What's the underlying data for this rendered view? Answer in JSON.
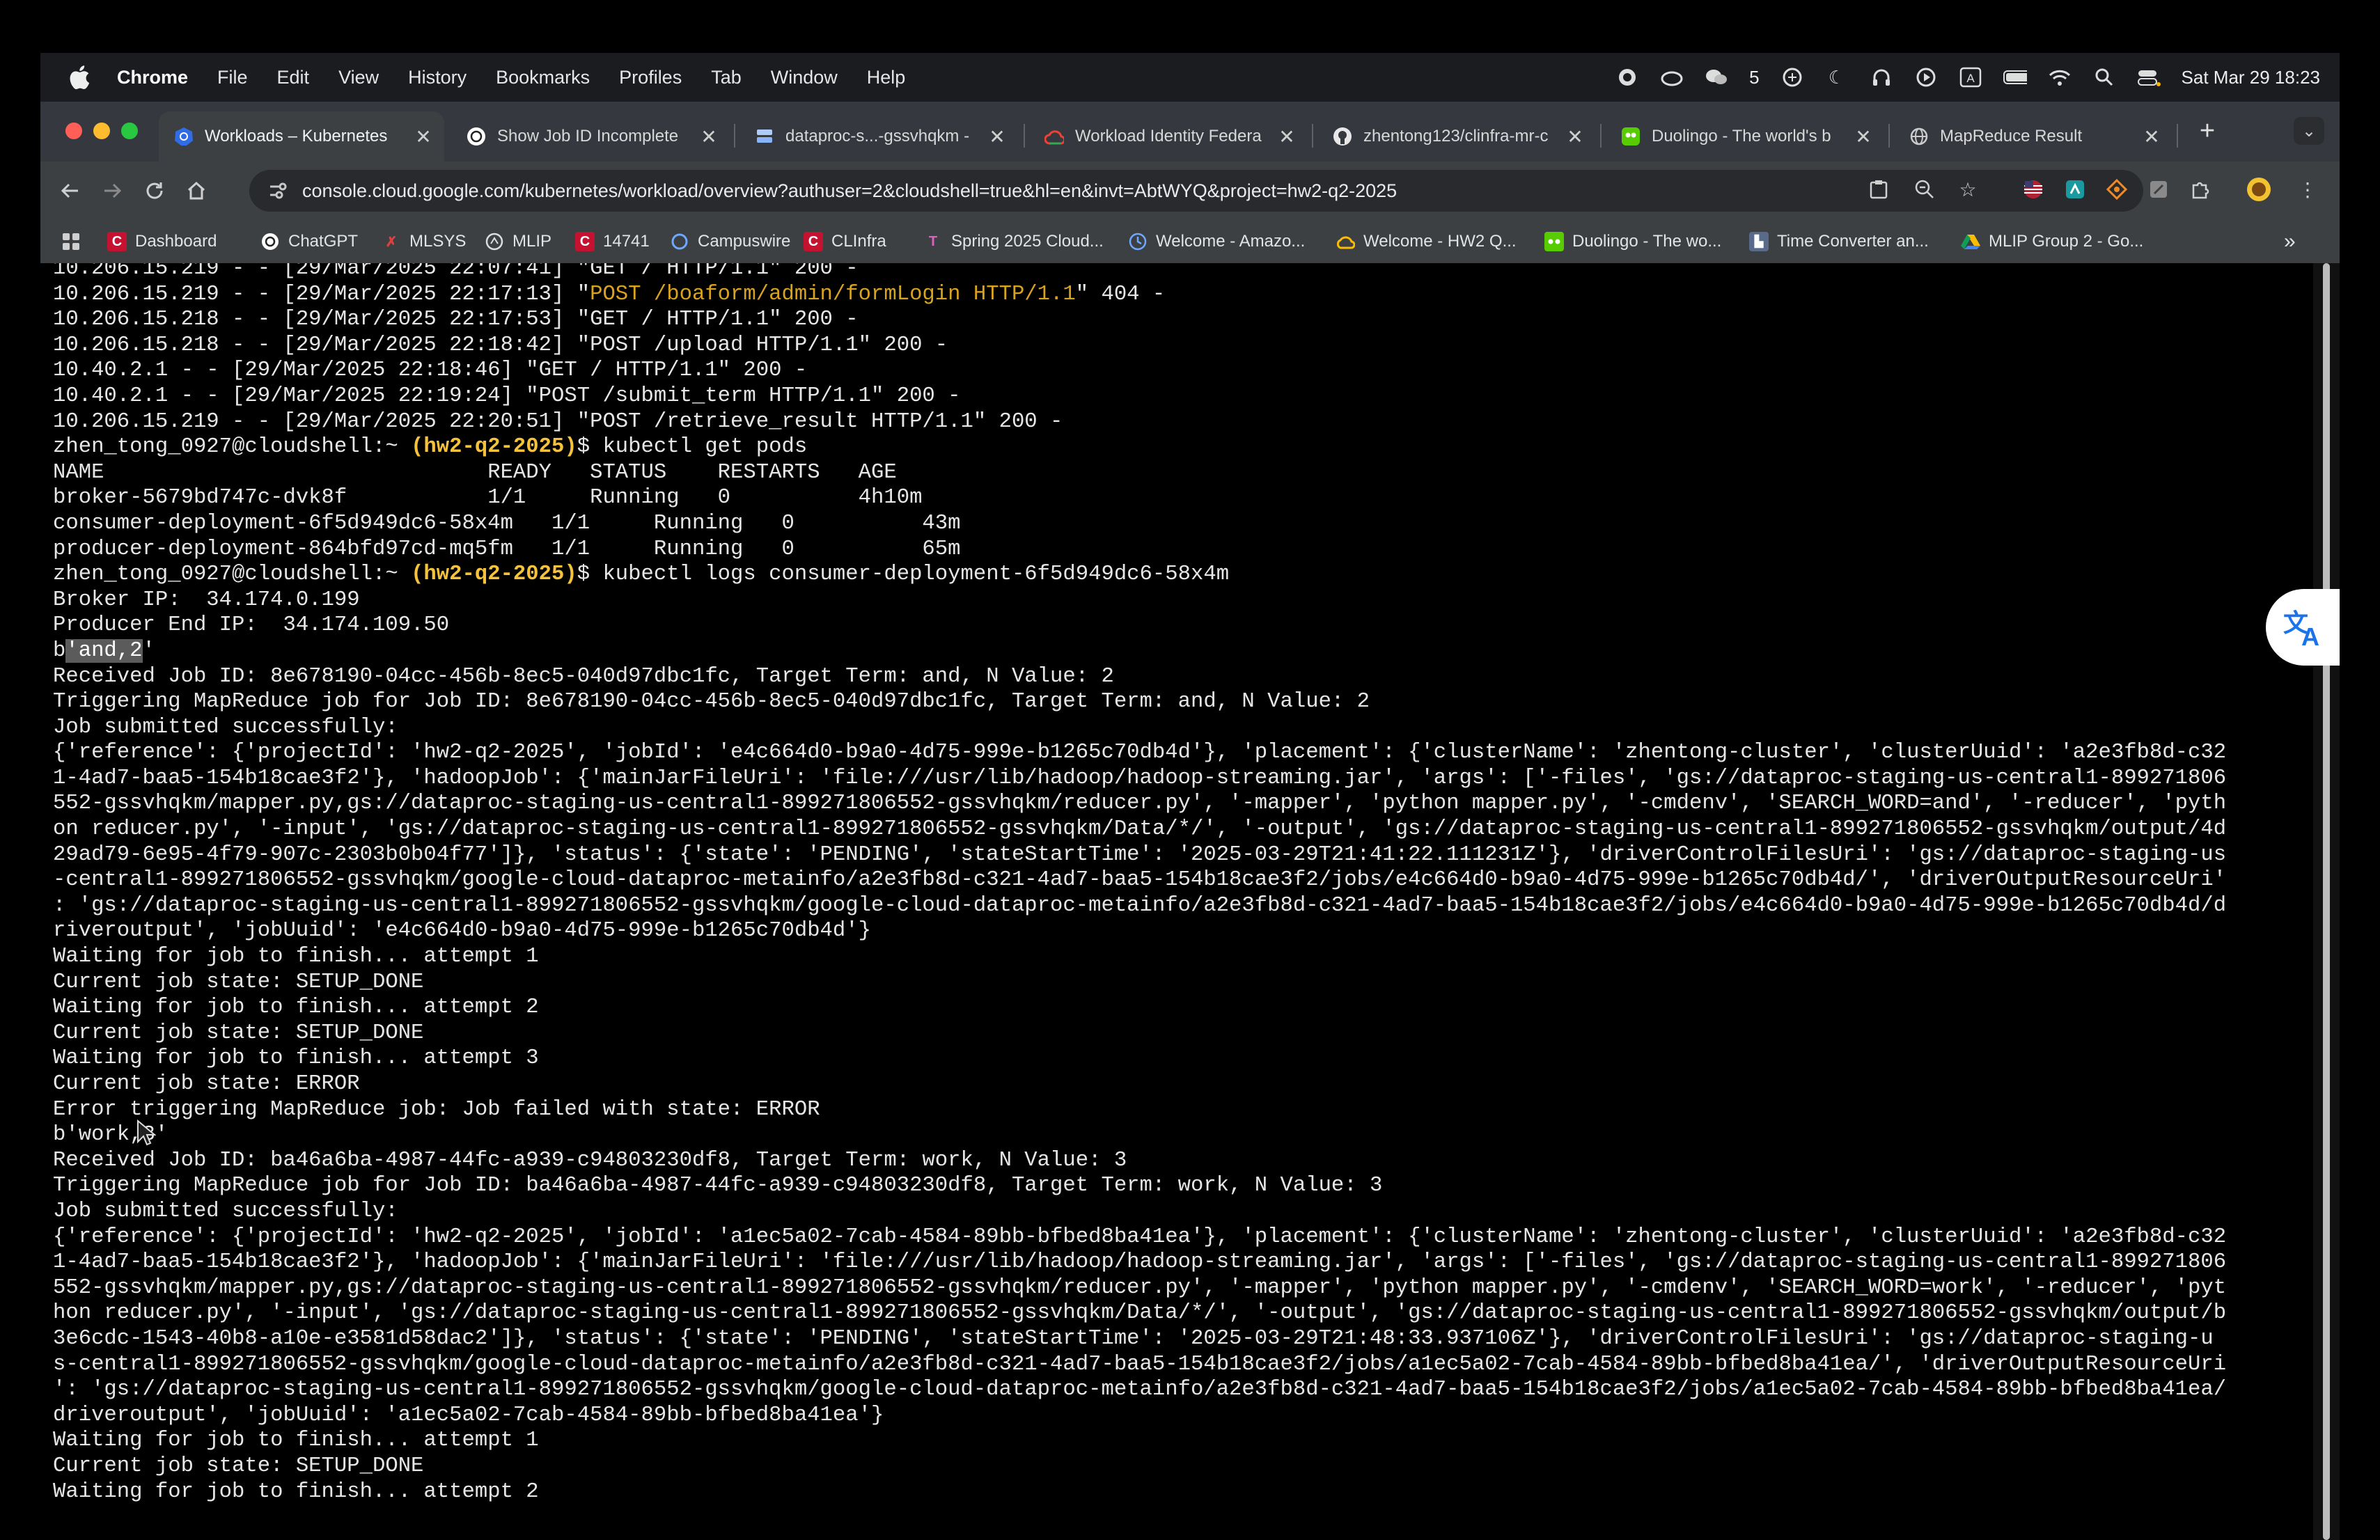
{
  "menubar": {
    "app": "Chrome",
    "items": [
      "File",
      "Edit",
      "View",
      "History",
      "Bookmarks",
      "Profiles",
      "Tab",
      "Window",
      "Help"
    ],
    "wechat_count": "5",
    "datetime": "Sat Mar 29  18:23"
  },
  "tabs": [
    {
      "title": "Workloads – Kubernetes",
      "icon": "kubernetes-icon",
      "active": true
    },
    {
      "title": "Show Job ID Incomplete",
      "icon": "chatgpt-icon"
    },
    {
      "title": "dataproc-s...-gssvhqkm -",
      "icon": "storage-icon"
    },
    {
      "title": "Workload Identity Federa",
      "icon": "google-cloud-icon"
    },
    {
      "title": "zhentong123/clinfra-mr-c",
      "icon": "github-icon"
    },
    {
      "title": "Duolingo - The world's b",
      "icon": "duolingo-icon"
    },
    {
      "title": "MapReduce Result",
      "icon": "globe-icon"
    }
  ],
  "address": {
    "url": "console.cloud.google.com/kubernetes/workload/overview?authuser=2&cloudshell=true&hl=en&invt=AbtWYQ&project=hw2-q2-2025"
  },
  "bookmarks": [
    {
      "label": "Dashboard",
      "icon": "canvas-icon"
    },
    {
      "label": "ChatGPT",
      "icon": "chatgpt-icon"
    },
    {
      "label": "MLSYS",
      "icon": "mlsys-icon"
    },
    {
      "label": "MLIP",
      "icon": "mlip-icon"
    },
    {
      "label": "14741",
      "icon": "canvas-icon"
    },
    {
      "label": "Campuswire",
      "icon": "campuswire-icon"
    },
    {
      "label": "CLInfra",
      "icon": "canvas-icon"
    },
    {
      "label": "Spring 2025 Cloud...",
      "icon": "cloud-icon"
    },
    {
      "label": "Welcome - Amazo...",
      "icon": "amazon-icon"
    },
    {
      "label": "Welcome - HW2 Q...",
      "icon": "google-cloud-icon"
    },
    {
      "label": "Duolingo - The wo...",
      "icon": "duolingo-icon"
    },
    {
      "label": "Time Converter an...",
      "icon": "time-icon"
    },
    {
      "label": "MLIP Group 2 - Go...",
      "icon": "drive-icon"
    }
  ],
  "bookmarks_more": "»",
  "terminal": {
    "lines": [
      {
        "t": "10.206.15.219 - - [29/Mar/2025 22:07:41] \"GET / HTTP/1.1\" 200 -"
      },
      {
        "t": "10.206.15.219 - - [29/Mar/2025 22:17:13] \"",
        "y": "POST /boaform/admin/formLogin HTTP/1.1",
        "r": "\" 404 -"
      },
      {
        "t": "10.206.15.218 - - [29/Mar/2025 22:17:53] \"GET / HTTP/1.1\" 200 -"
      },
      {
        "t": "10.206.15.218 - - [29/Mar/2025 22:18:42] \"POST /upload HTTP/1.1\" 200 -"
      },
      {
        "t": "10.40.2.1 - - [29/Mar/2025 22:18:46] \"GET / HTTP/1.1\" 200 -"
      },
      {
        "t": "10.40.2.1 - - [29/Mar/2025 22:19:24] \"POST /submit_term HTTP/1.1\" 200 -"
      },
      {
        "t": "10.206.15.219 - - [29/Mar/2025 22:20:51] \"POST /retrieve_result HTTP/1.1\" 200 -"
      },
      {
        "p": "zhen_tong_0927@cloudshell:~ ",
        "pp": "(hw2-q2-2025)",
        "c": "$ kubectl get pods"
      },
      {
        "t": "NAME                              READY   STATUS    RESTARTS   AGE"
      },
      {
        "t": "broker-5679bd747c-dvk8f           1/1     Running   0          4h10m"
      },
      {
        "t": "consumer-deployment-6f5d949dc6-58x4m   1/1     Running   0          43m"
      },
      {
        "t": "producer-deployment-864bfd97cd-mq5fm   1/1     Running   0          65m"
      },
      {
        "p": "zhen_tong_0927@cloudshell:~ ",
        "pp": "(hw2-q2-2025)",
        "c": "$ kubectl logs consumer-deployment-6f5d949dc6-58x4m"
      },
      {
        "t": "Broker IP:  34.174.0.199"
      },
      {
        "t": "Producer End IP:  34.174.109.50"
      },
      {
        "a": "b",
        "h": "'and,2",
        "r": "'"
      },
      {
        "t": "Received Job ID: 8e678190-04cc-456b-8ec5-040d97dbc1fc, Target Term: and, N Value: 2"
      },
      {
        "t": "Triggering MapReduce job for Job ID: 8e678190-04cc-456b-8ec5-040d97dbc1fc, Target Term: and, N Value: 2"
      },
      {
        "t": "Job submitted successfully:"
      },
      {
        "t": "{'reference': {'projectId': 'hw2-q2-2025', 'jobId': 'e4c664d0-b9a0-4d75-999e-b1265c70db4d'}, 'placement': {'clusterName': 'zhentong-cluster', 'clusterUuid': 'a2e3fb8d-c32"
      },
      {
        "t": "1-4ad7-baa5-154b18cae3f2'}, 'hadoopJob': {'mainJarFileUri': 'file:///usr/lib/hadoop/hadoop-streaming.jar', 'args': ['-files', 'gs://dataproc-staging-us-central1-899271806"
      },
      {
        "t": "552-gssvhqkm/mapper.py,gs://dataproc-staging-us-central1-899271806552-gssvhqkm/reducer.py', '-mapper', 'python mapper.py', '-cmdenv', 'SEARCH_WORD=and', '-reducer', 'pyth"
      },
      {
        "t": "on reducer.py', '-input', 'gs://dataproc-staging-us-central1-899271806552-gssvhqkm/Data/*/', '-output', 'gs://dataproc-staging-us-central1-899271806552-gssvhqkm/output/4d"
      },
      {
        "t": "29ad79-6e95-4f79-907c-2303b0b04f77']}, 'status': {'state': 'PENDING', 'stateStartTime': '2025-03-29T21:41:22.111231Z'}, 'driverControlFilesUri': 'gs://dataproc-staging-us"
      },
      {
        "t": "-central1-899271806552-gssvhqkm/google-cloud-dataproc-metainfo/a2e3fb8d-c321-4ad7-baa5-154b18cae3f2/jobs/e4c664d0-b9a0-4d75-999e-b1265c70db4d/', 'driverOutputResourceUri'"
      },
      {
        "t": ": 'gs://dataproc-staging-us-central1-899271806552-gssvhqkm/google-cloud-dataproc-metainfo/a2e3fb8d-c321-4ad7-baa5-154b18cae3f2/jobs/e4c664d0-b9a0-4d75-999e-b1265c70db4d/d"
      },
      {
        "t": "riveroutput', 'jobUuid': 'e4c664d0-b9a0-4d75-999e-b1265c70db4d'}"
      },
      {
        "t": "Waiting for job to finish... attempt 1"
      },
      {
        "t": "Current job state: SETUP_DONE"
      },
      {
        "t": "Waiting for job to finish... attempt 2"
      },
      {
        "t": "Current job state: SETUP_DONE"
      },
      {
        "t": "Waiting for job to finish... attempt 3"
      },
      {
        "t": "Current job state: ERROR"
      },
      {
        "t": "Error triggering MapReduce job: Job failed with state: ERROR"
      },
      {
        "t": "b'work,3'"
      },
      {
        "t": "Received Job ID: ba46a6ba-4987-44fc-a939-c94803230df8, Target Term: work, N Value: 3"
      },
      {
        "t": "Triggering MapReduce job for Job ID: ba46a6ba-4987-44fc-a939-c94803230df8, Target Term: work, N Value: 3"
      },
      {
        "t": "Job submitted successfully:"
      },
      {
        "t": "{'reference': {'projectId': 'hw2-q2-2025', 'jobId': 'a1ec5a02-7cab-4584-89bb-bfbed8ba41ea'}, 'placement': {'clusterName': 'zhentong-cluster', 'clusterUuid': 'a2e3fb8d-c32"
      },
      {
        "t": "1-4ad7-baa5-154b18cae3f2'}, 'hadoopJob': {'mainJarFileUri': 'file:///usr/lib/hadoop/hadoop-streaming.jar', 'args': ['-files', 'gs://dataproc-staging-us-central1-899271806"
      },
      {
        "t": "552-gssvhqkm/mapper.py,gs://dataproc-staging-us-central1-899271806552-gssvhqkm/reducer.py', '-mapper', 'python mapper.py', '-cmdenv', 'SEARCH_WORD=work', '-reducer', 'pyt"
      },
      {
        "t": "hon reducer.py', '-input', 'gs://dataproc-staging-us-central1-899271806552-gssvhqkm/Data/*/', '-output', 'gs://dataproc-staging-us-central1-899271806552-gssvhqkm/output/b"
      },
      {
        "t": "3e6cdc-1543-40b8-a10e-e3581d58dac2']}, 'status': {'state': 'PENDING', 'stateStartTime': '2025-03-29T21:48:33.937106Z'}, 'driverControlFilesUri': 'gs://dataproc-staging-u"
      },
      {
        "t": "s-central1-899271806552-gssvhqkm/google-cloud-dataproc-metainfo/a2e3fb8d-c321-4ad7-baa5-154b18cae3f2/jobs/a1ec5a02-7cab-4584-89bb-bfbed8ba41ea/', 'driverOutputResourceUri"
      },
      {
        "t": "': 'gs://dataproc-staging-us-central1-899271806552-gssvhqkm/google-cloud-dataproc-metainfo/a2e3fb8d-c321-4ad7-baa5-154b18cae3f2/jobs/a1ec5a02-7cab-4584-89bb-bfbed8ba41ea/"
      },
      {
        "t": "driveroutput', 'jobUuid': 'a1ec5a02-7cab-4584-89bb-bfbed8ba41ea'}"
      },
      {
        "t": "Waiting for job to finish... attempt 1"
      },
      {
        "t": "Current job state: SETUP_DONE"
      },
      {
        "t": "Waiting for job to finish... attempt 2"
      }
    ]
  },
  "colors": {
    "prompt_project": "#f5c23b",
    "http_path_highlight": "#d9a21f",
    "selection": "#5b5b5b",
    "tabstrip": "#35393f",
    "toolbar": "#3c4043"
  }
}
